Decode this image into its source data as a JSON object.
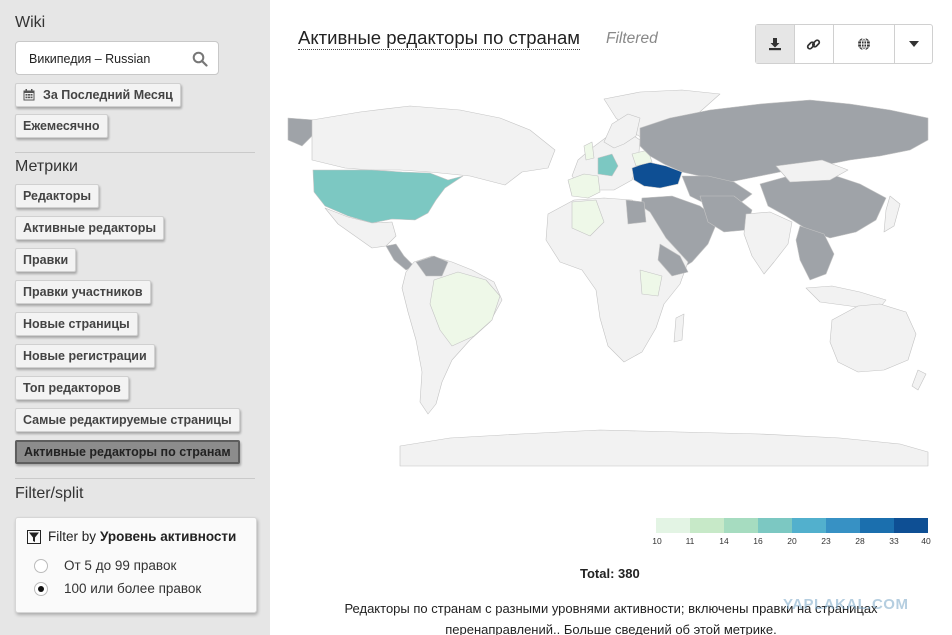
{
  "sidebar": {
    "wiki_title": "Wiki",
    "wiki_value": "Википедия – Russian",
    "period_button": "За Последний Месяц",
    "granularity_button": "Ежемесячно",
    "metrics_title": "Метрики",
    "metrics": [
      "Редакторы",
      "Активные редакторы",
      "Правки",
      "Правки участников",
      "Новые страницы",
      "Новые регистрации",
      "Топ редакторов",
      "Самые редактируемые страницы",
      "Активные редакторы по странам"
    ],
    "active_metric_index": 8,
    "filter_title": "Filter/split",
    "filter": {
      "prefix": "Filter by",
      "field": "Уровень активности",
      "options": [
        "От 5 до 99 правок",
        "100 или более правок"
      ],
      "selected_index": 1
    }
  },
  "main": {
    "title": "Активные редакторы по странам",
    "filtered_label": "Filtered",
    "toolbar_icons": [
      "download-icon",
      "link-icon",
      "globe-icon",
      "caret-down-icon"
    ],
    "legend": {
      "ticks": [
        "10",
        "11",
        "14",
        "16",
        "20",
        "23",
        "28",
        "33",
        "40"
      ],
      "colors": [
        "#e3f4e4",
        "#c7e9c8",
        "#a6dcc0",
        "#7cc8c2",
        "#52b0cd",
        "#3791c4",
        "#1b6fae",
        "#0e4f94"
      ]
    },
    "total": "Total: 380",
    "description": "Редакторы по странам с разными уровнями активности; включены правки на страницах перенаправлений..",
    "more_link": "Больше сведений об этой метрике",
    "more_suffix": ".",
    "watermark": "YAPLAKAL.COM"
  },
  "colors": {
    "sidebar_bg": "#e6e6e6",
    "no_data": "#f2f2f2",
    "masked": "#9fa3a8",
    "highest": "#0e4f94",
    "us_fill": "#7cc8c2",
    "germany_fill": "#7cc8c2"
  }
}
